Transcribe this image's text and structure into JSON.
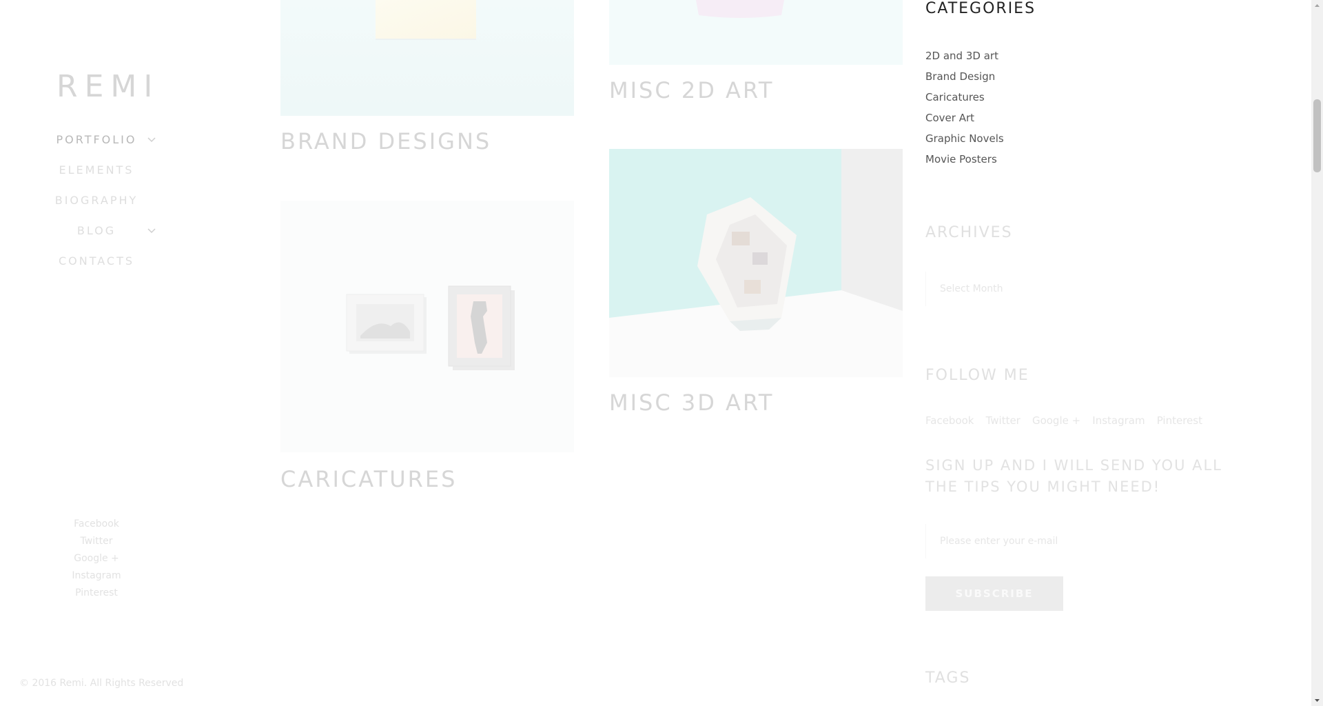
{
  "sidebar": {
    "logo": "REMI",
    "menu": [
      {
        "label": "PORTFOLIO",
        "has_submenu": true
      },
      {
        "label": "ELEMENTS",
        "has_submenu": false
      },
      {
        "label": "BIOGRAPHY",
        "has_submenu": false
      },
      {
        "label": "BLOG",
        "has_submenu": true
      },
      {
        "label": "CONTACTS",
        "has_submenu": false
      }
    ],
    "social": [
      "Facebook",
      "Twitter",
      "Google +",
      "Instagram",
      "Pinterest"
    ],
    "copyright": "© 2016 Remi. All Rights Reserved"
  },
  "portfolio": {
    "items": [
      {
        "title": "BRAND DESIGNS",
        "image": "brand-designs-image"
      },
      {
        "title": "MISC 2D ART",
        "image": "misc-2d-art-image"
      },
      {
        "title": "CARICATURES",
        "image": "caricatures-image"
      },
      {
        "title": "MISC 3D ART",
        "image": "misc-3d-art-image"
      }
    ]
  },
  "widgets": {
    "categories": {
      "title": "CATEGORIES",
      "items": [
        "2D and 3D art",
        "Brand Design",
        "Caricatures",
        "Cover Art",
        "Graphic Novels",
        "Movie Posters"
      ]
    },
    "archives": {
      "title": "ARCHIVES",
      "placeholder": "Select Month"
    },
    "follow": {
      "title": "FOLLOW ME",
      "links": [
        "Facebook",
        "Twitter",
        "Google +",
        "Instagram",
        "Pinterest"
      ]
    },
    "signup": {
      "title": "SIGN UP AND I WILL SEND YOU ALL THE TIPS YOU MIGHT NEED!",
      "email_placeholder": "Please enter your e-mail",
      "button": "SUBSCRIBE"
    },
    "tags": {
      "title": "TAGS"
    }
  },
  "colors": {
    "text_dark": "#222222",
    "text_faded": "#d6d6d6",
    "button_bg": "#ececec",
    "mint": "#cdeeed"
  }
}
